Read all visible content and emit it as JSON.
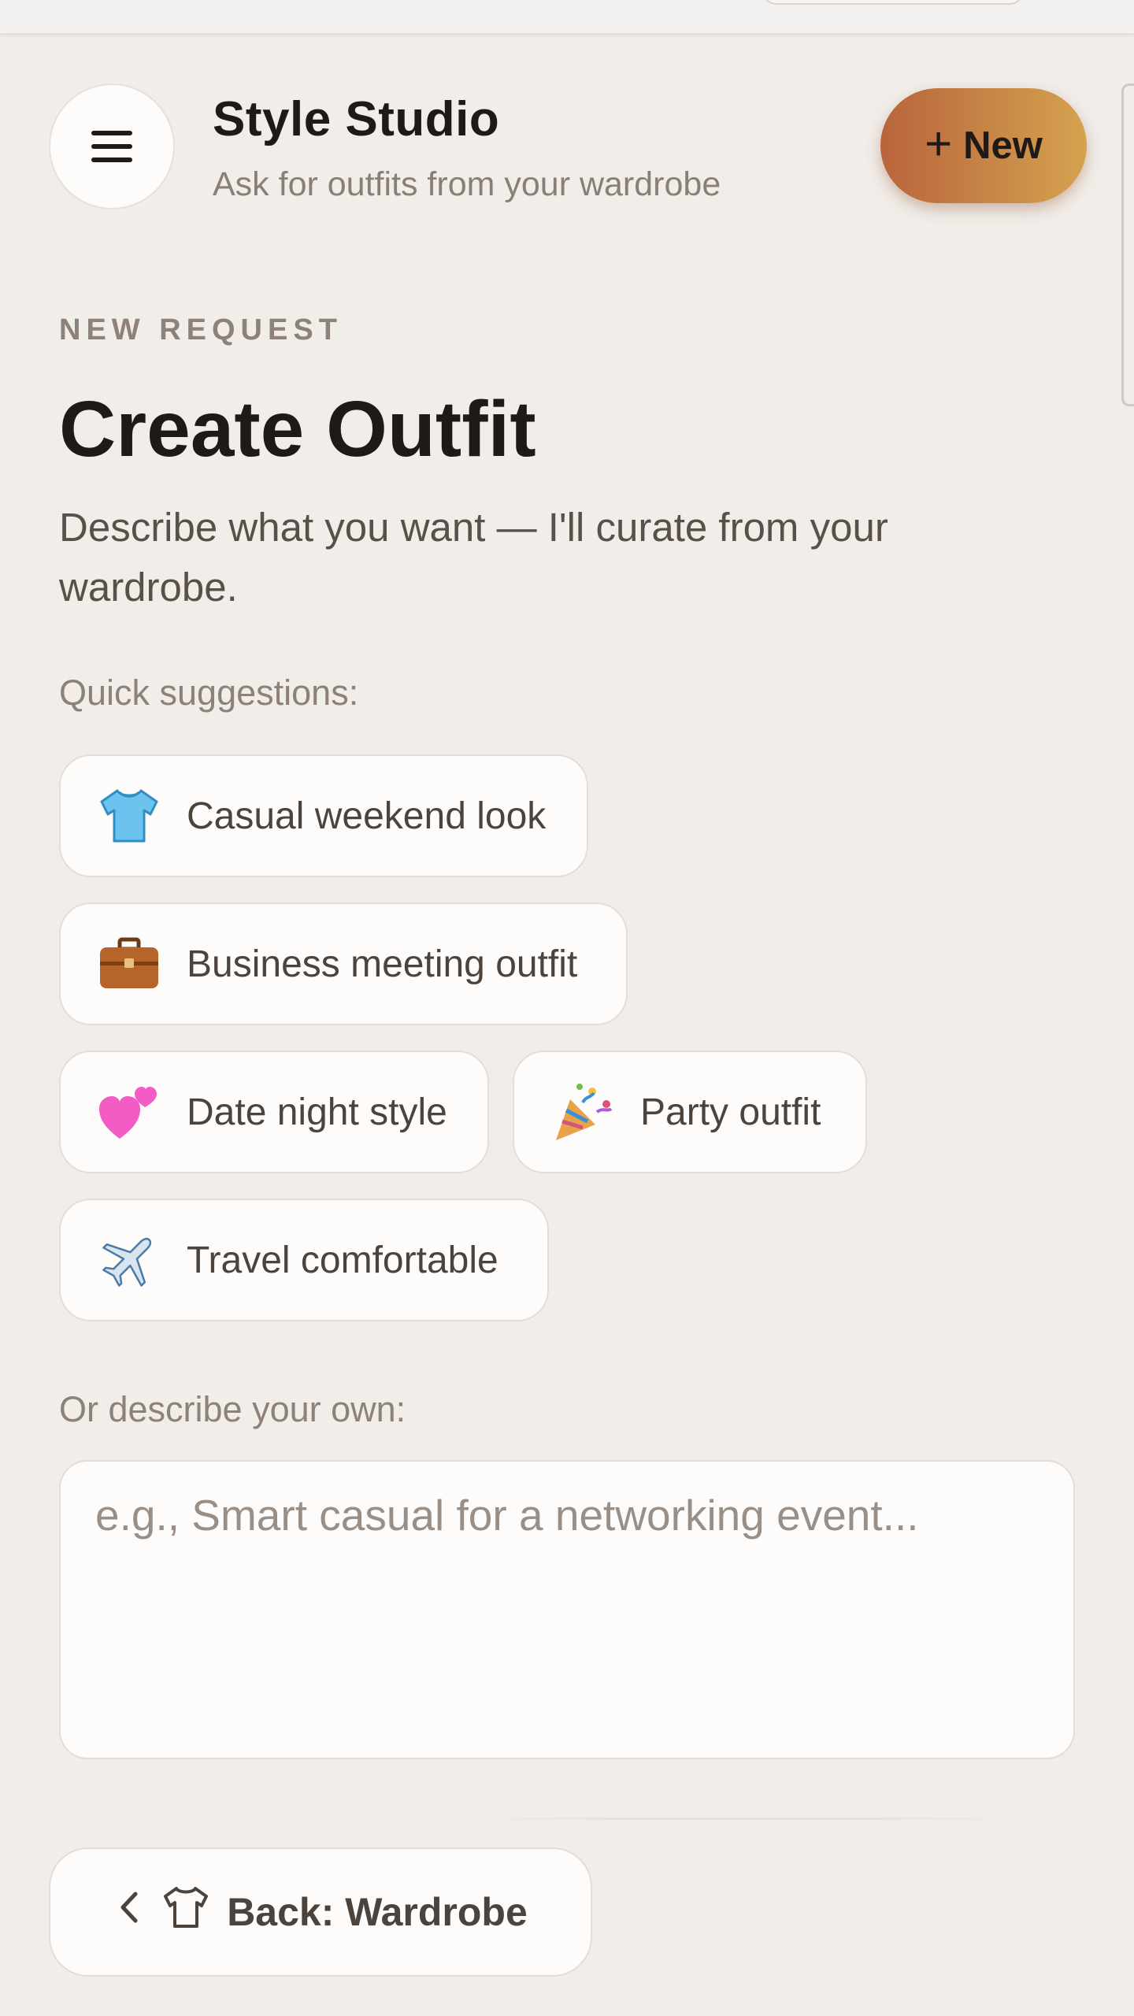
{
  "header": {
    "title": "Style Studio",
    "subtitle": "Ask for outfits from your wardrobe",
    "menu_icon": "hamburger-menu-icon",
    "new_button": {
      "icon": "+",
      "label": "New"
    }
  },
  "main": {
    "eyebrow": "NEW REQUEST",
    "title": "Create Outfit",
    "description": "Describe what you want — I'll curate from your wardrobe.",
    "suggestions_label": "Quick suggestions:",
    "suggestions": [
      {
        "icon": "t-shirt-icon",
        "label": "Casual weekend look"
      },
      {
        "icon": "briefcase-icon",
        "label": "Business meeting outfit"
      },
      {
        "icon": "two-hearts-icon",
        "label": "Date night style"
      },
      {
        "icon": "party-popper-icon",
        "label": "Party outfit"
      },
      {
        "icon": "airplane-icon",
        "label": "Travel comfortable"
      }
    ],
    "custom_label": "Or describe your own:",
    "custom_input": {
      "value": "",
      "placeholder": "e.g., Smart casual for a networking event..."
    }
  },
  "footer": {
    "back_button": {
      "label": "Back: Wardrobe",
      "icons": [
        "chevron-left-icon",
        "shirt-icon"
      ]
    }
  },
  "colors": {
    "background": "#f1ede9",
    "card": "#fefcfa",
    "accent_start": "#b9643c",
    "accent_end": "#d6a24f",
    "text_primary": "#1f1a17",
    "text_muted": "#8e8179"
  }
}
